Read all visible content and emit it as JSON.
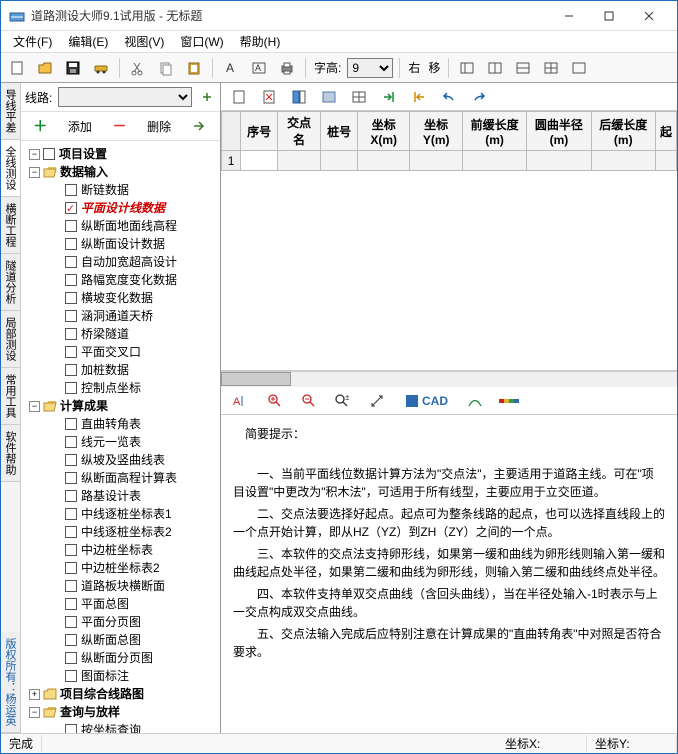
{
  "title": "道路测设大师9.1试用版 - 无标题",
  "menu": [
    "文件(F)",
    "编辑(E)",
    "视图(V)",
    "窗口(W)",
    "帮助(H)"
  ],
  "toolbar": {
    "font_height_label": "字高:",
    "font_height_value": "9",
    "right_label": "右",
    "shift_label": "移"
  },
  "left": {
    "route_label": "线路:",
    "add_label": "添加",
    "del_label": "删除",
    "vtabs": [
      "导线平差",
      "全线测设",
      "横断工程",
      "隧道分析",
      "局部测设",
      "常用工具",
      "软件帮助"
    ],
    "vfooter": "版权所有：杨运英"
  },
  "tree": [
    {
      "lvl": 1,
      "exp": "-",
      "label": "项目设置",
      "bold": true
    },
    {
      "lvl": 1,
      "exp": "-",
      "label": "数据输入",
      "bold": true,
      "folder": "open"
    },
    {
      "lvl": 2,
      "label": "断链数据"
    },
    {
      "lvl": 2,
      "label": "平面设计线数据",
      "red": true,
      "checked": true
    },
    {
      "lvl": 2,
      "label": "纵断面地面线高程"
    },
    {
      "lvl": 2,
      "label": "纵断面设计数据"
    },
    {
      "lvl": 2,
      "label": "自动加宽超高设计"
    },
    {
      "lvl": 2,
      "label": "路幅宽度变化数据"
    },
    {
      "lvl": 2,
      "label": "横坡变化数据"
    },
    {
      "lvl": 2,
      "label": "涵洞通道天桥"
    },
    {
      "lvl": 2,
      "label": "桥梁隧道"
    },
    {
      "lvl": 2,
      "label": "平面交叉口"
    },
    {
      "lvl": 2,
      "label": "加桩数据"
    },
    {
      "lvl": 2,
      "label": "控制点坐标"
    },
    {
      "lvl": 1,
      "exp": "-",
      "label": "计算成果",
      "bold": true,
      "folder": "open"
    },
    {
      "lvl": 2,
      "label": "直曲转角表"
    },
    {
      "lvl": 2,
      "label": "线元一览表"
    },
    {
      "lvl": 2,
      "label": "纵坡及竖曲线表"
    },
    {
      "lvl": 2,
      "label": "纵断面高程计算表"
    },
    {
      "lvl": 2,
      "label": "路基设计表"
    },
    {
      "lvl": 2,
      "label": "中线逐桩坐标表1"
    },
    {
      "lvl": 2,
      "label": "中线逐桩坐标表2"
    },
    {
      "lvl": 2,
      "label": "中边桩坐标表"
    },
    {
      "lvl": 2,
      "label": "中边桩坐标表2"
    },
    {
      "lvl": 2,
      "label": "道路板块横断面"
    },
    {
      "lvl": 2,
      "label": "平面总图"
    },
    {
      "lvl": 2,
      "label": "平面分页图"
    },
    {
      "lvl": 2,
      "label": "纵断面总图"
    },
    {
      "lvl": 2,
      "label": "纵断面分页图"
    },
    {
      "lvl": 2,
      "label": "图面标注"
    },
    {
      "lvl": 1,
      "exp": "+",
      "label": "项目综合线路图",
      "bold": true,
      "folder": "closed"
    },
    {
      "lvl": 1,
      "exp": "-",
      "label": "查询与放样",
      "bold": true,
      "folder": "open"
    },
    {
      "lvl": 2,
      "label": "按坐标查询"
    }
  ],
  "grid": {
    "cols": [
      "序号",
      "交点名",
      "桩号",
      "坐标X(m)",
      "坐标Y(m)",
      "前缓长度(m)",
      "圆曲半径(m)",
      "后缓长度(m)",
      "起"
    ],
    "row1": "1"
  },
  "bottom_tb": {
    "cad": "CAD"
  },
  "hints": {
    "title": "简要提示：",
    "p1": "一、当前平面线位数据计算方法为\"交点法\"，主要适用于道路主线。可在\"项目设置\"中更改为\"积木法\"，可适用于所有线型，主要应用于立交匝道。",
    "p2": "二、交点法要选择好起点。起点可为整条线路的起点，也可以选择直线段上的一个点开始计算，即从HZ（YZ）到ZH（ZY）之间的一个点。",
    "p3": "三、本软件的交点法支持卵形线，如果第一缓和曲线为卵形线则输入第一缓和曲线起点处半径，如果第二缓和曲线为卵形线，则输入第二缓和曲线终点处半径。",
    "p4": "四、本软件支持单双交点曲线（含回头曲线），当在半径处输入-1时表示与上一交点构成双交点曲线。",
    "p5": "五、交点法输入完成后应特别注意在计算成果的\"直曲转角表\"中对照是否符合要求。"
  },
  "status": {
    "done": "完成",
    "x": "坐标X:",
    "y": "坐标Y:"
  }
}
